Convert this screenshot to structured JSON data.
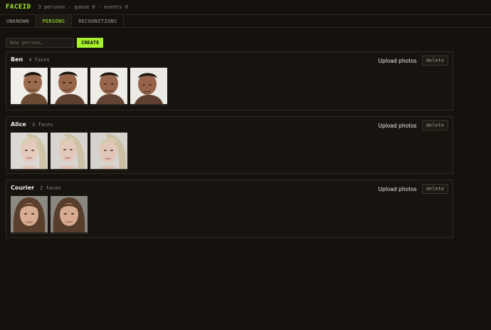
{
  "app": {
    "brand": "FACEID",
    "stats": "3 persons · queue 0 · events 0"
  },
  "tabs": [
    {
      "label": "UNKNOWN"
    },
    {
      "label": "PERSONS"
    },
    {
      "label": "RECOGNITIONS"
    }
  ],
  "create": {
    "placeholder": "New person…",
    "button_label": "CREATE"
  },
  "persons": [
    {
      "name": "Ben",
      "faces_label": "4 faces",
      "upload_label": "Upload photos",
      "delete_label": "delete"
    },
    {
      "name": "Alice",
      "faces_label": "3 faces",
      "upload_label": "Upload photos",
      "delete_label": "delete"
    },
    {
      "name": "Courier",
      "faces_label": "2 faces",
      "upload_label": "Upload photos",
      "delete_label": "delete"
    }
  ],
  "colors": {
    "accent": "#a6f12f",
    "background": "#15120e"
  }
}
